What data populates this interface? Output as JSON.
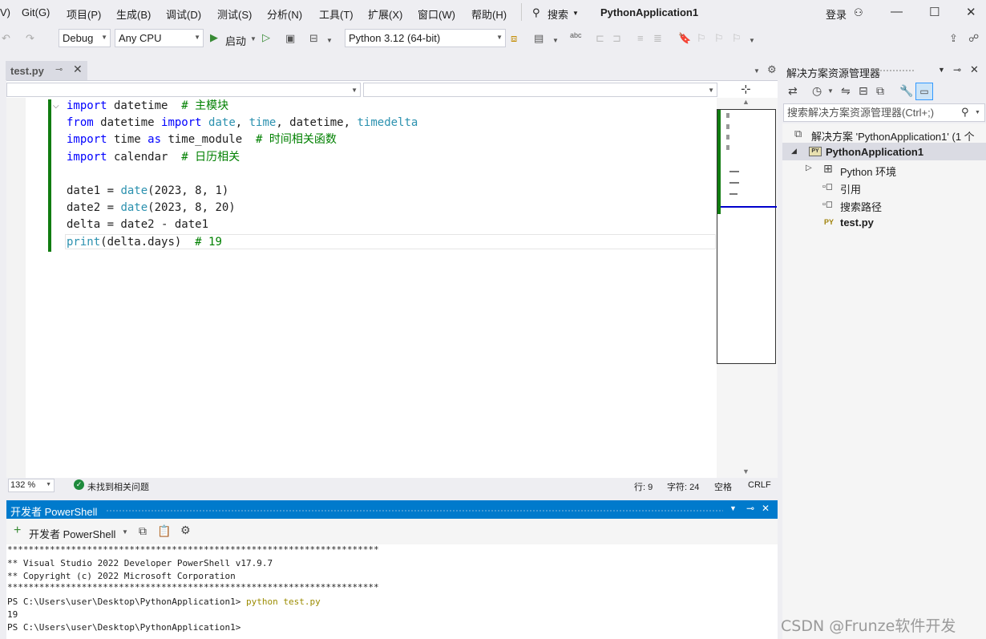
{
  "menu": {
    "items": [
      "Git(G)",
      "项目(P)",
      "生成(B)",
      "调试(D)",
      "测试(S)",
      "分析(N)",
      "工具(T)",
      "扩展(X)",
      "窗口(W)",
      "帮助(H)"
    ],
    "partial_left": "V)",
    "search_label": "搜索",
    "window_title": "PythonApplication1",
    "login_label": "登录"
  },
  "toolbar": {
    "config": "Debug",
    "platform": "Any CPU",
    "start_label": "启动",
    "environment": "Python 3.12 (64-bit)"
  },
  "editor": {
    "tab_title": "test.py",
    "lines": [
      {
        "text_parts": [
          {
            "t": "import",
            "c": "kw"
          },
          {
            "t": " datetime  ",
            "c": ""
          },
          {
            "t": "# 主模块",
            "c": "cm"
          }
        ]
      },
      {
        "text_parts": [
          {
            "t": "from",
            "c": "kw"
          },
          {
            "t": " datetime ",
            "c": ""
          },
          {
            "t": "import",
            "c": "kw"
          },
          {
            "t": " ",
            "c": ""
          },
          {
            "t": "date",
            "c": "fn"
          },
          {
            "t": ", ",
            "c": ""
          },
          {
            "t": "time",
            "c": "fn"
          },
          {
            "t": ", datetime, ",
            "c": ""
          },
          {
            "t": "timedelta",
            "c": "fn"
          }
        ]
      },
      {
        "text_parts": [
          {
            "t": "import",
            "c": "kw"
          },
          {
            "t": " time ",
            "c": ""
          },
          {
            "t": "as",
            "c": "kw"
          },
          {
            "t": " time_module  ",
            "c": ""
          },
          {
            "t": "# 时间相关函数",
            "c": "cm"
          }
        ]
      },
      {
        "text_parts": [
          {
            "t": "import",
            "c": "kw"
          },
          {
            "t": " calendar  ",
            "c": ""
          },
          {
            "t": "# 日历相关",
            "c": "cm"
          }
        ]
      },
      {
        "text_parts": []
      },
      {
        "text_parts": [
          {
            "t": "date1 = ",
            "c": ""
          },
          {
            "t": "date",
            "c": "fn"
          },
          {
            "t": "(2023, 8, 1)",
            "c": ""
          }
        ]
      },
      {
        "text_parts": [
          {
            "t": "date2 = ",
            "c": ""
          },
          {
            "t": "date",
            "c": "fn"
          },
          {
            "t": "(2023, 8, 20)",
            "c": ""
          }
        ]
      },
      {
        "text_parts": [
          {
            "t": "delta = date2 - date1",
            "c": ""
          }
        ]
      },
      {
        "text_parts": [
          {
            "t": "print",
            "c": "fn"
          },
          {
            "t": "(delta.days)  ",
            "c": ""
          },
          {
            "t": "# 19",
            "c": "cm"
          }
        ]
      }
    ]
  },
  "status": {
    "zoom": "132 %",
    "issues": "未找到相关问题",
    "line": "行: 9",
    "char": "字符: 24",
    "whitespace": "空格",
    "eol": "CRLF"
  },
  "powershell": {
    "pane_title": "开发者 PowerShell",
    "new_button": "开发者 PowerShell",
    "terminal": {
      "stars": "**********************************************************************",
      "banner1": "** Visual Studio 2022 Developer PowerShell v17.9.7",
      "banner2": "** Copyright (c) 2022 Microsoft Corporation",
      "stars2": "**********************************************************************",
      "prompt1": "PS C:\\Users\\user\\Desktop\\PythonApplication1> ",
      "cmd1": "python test.py",
      "output1": "19",
      "prompt2": "PS C:\\Users\\user\\Desktop\\PythonApplication1>"
    }
  },
  "solution_explorer": {
    "title": "解决方案资源管理器",
    "search_placeholder": "搜索解决方案资源管理器(Ctrl+;)",
    "tree": {
      "solution": "解决方案 'PythonApplication1' (1 个",
      "project": "PythonApplication1",
      "python_env": "Python 环境",
      "references": "引用",
      "search_paths": "搜索路径",
      "file": "test.py"
    },
    "py_badge": "PY"
  },
  "watermark": "CSDN @Frunze软件开发"
}
